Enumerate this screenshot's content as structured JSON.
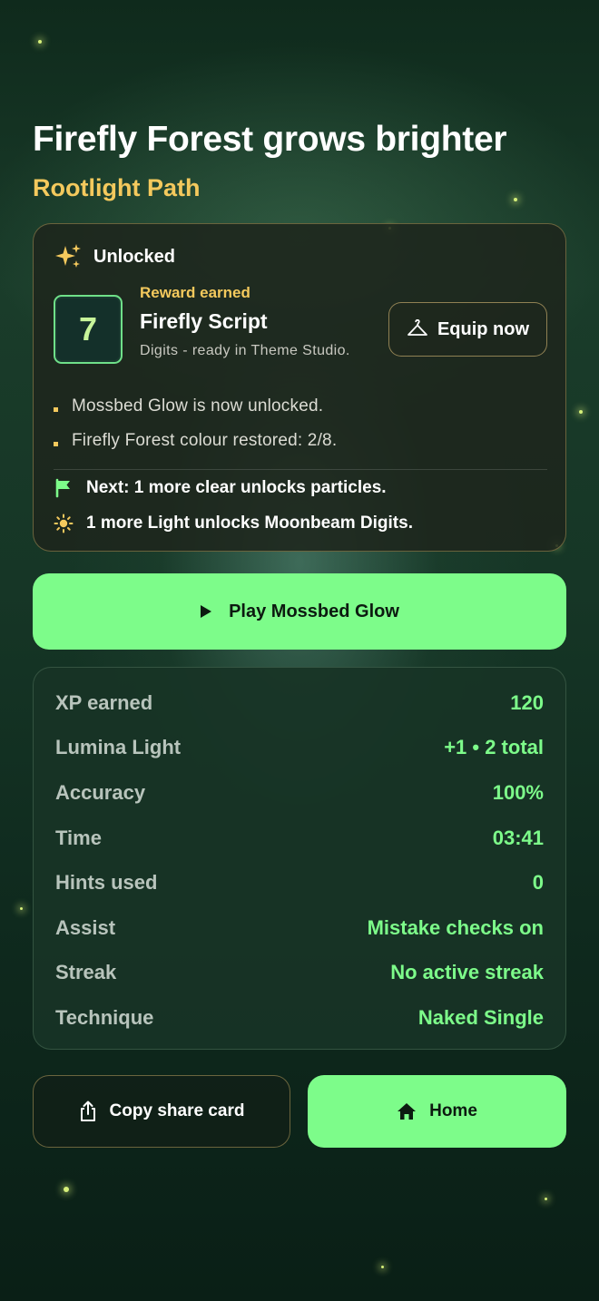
{
  "header": {
    "title": "Firefly Forest grows brighter",
    "subtitle": "Rootlight Path"
  },
  "reward_card": {
    "status_icon": "sparkles-icon",
    "status_label": "Unlocked",
    "tile_digit": "7",
    "eyebrow": "Reward earned",
    "name": "Firefly Script",
    "description": "Digits - ready in Theme Studio.",
    "equip_icon": "hanger-icon",
    "equip_label": "Equip now",
    "bullets": [
      "Mossbed Glow is now unlocked.",
      "Firefly Forest colour restored: 2/8."
    ],
    "next_icon": "flag-icon",
    "next_text": "Next: 1 more clear unlocks particles.",
    "light_icon": "sun-icon",
    "light_text": "1 more Light unlocks Moonbeam Digits."
  },
  "play_button": {
    "icon": "play-icon",
    "label": "Play Mossbed Glow"
  },
  "stats": [
    {
      "label": "XP earned",
      "value": "120"
    },
    {
      "label": "Lumina Light",
      "value": "+1 • 2 total"
    },
    {
      "label": "Accuracy",
      "value": "100%"
    },
    {
      "label": "Time",
      "value": "03:41"
    },
    {
      "label": "Hints used",
      "value": "0"
    },
    {
      "label": "Assist",
      "value": "Mistake checks on"
    },
    {
      "label": "Streak",
      "value": "No active streak"
    },
    {
      "label": "Technique",
      "value": "Naked Single"
    }
  ],
  "actions": {
    "share_icon": "share-icon",
    "share_label": "Copy share card",
    "home_icon": "home-icon",
    "home_label": "Home"
  },
  "colors": {
    "accent_green": "#7dfc8a",
    "accent_gold": "#f4c95d",
    "background": "#163626"
  }
}
